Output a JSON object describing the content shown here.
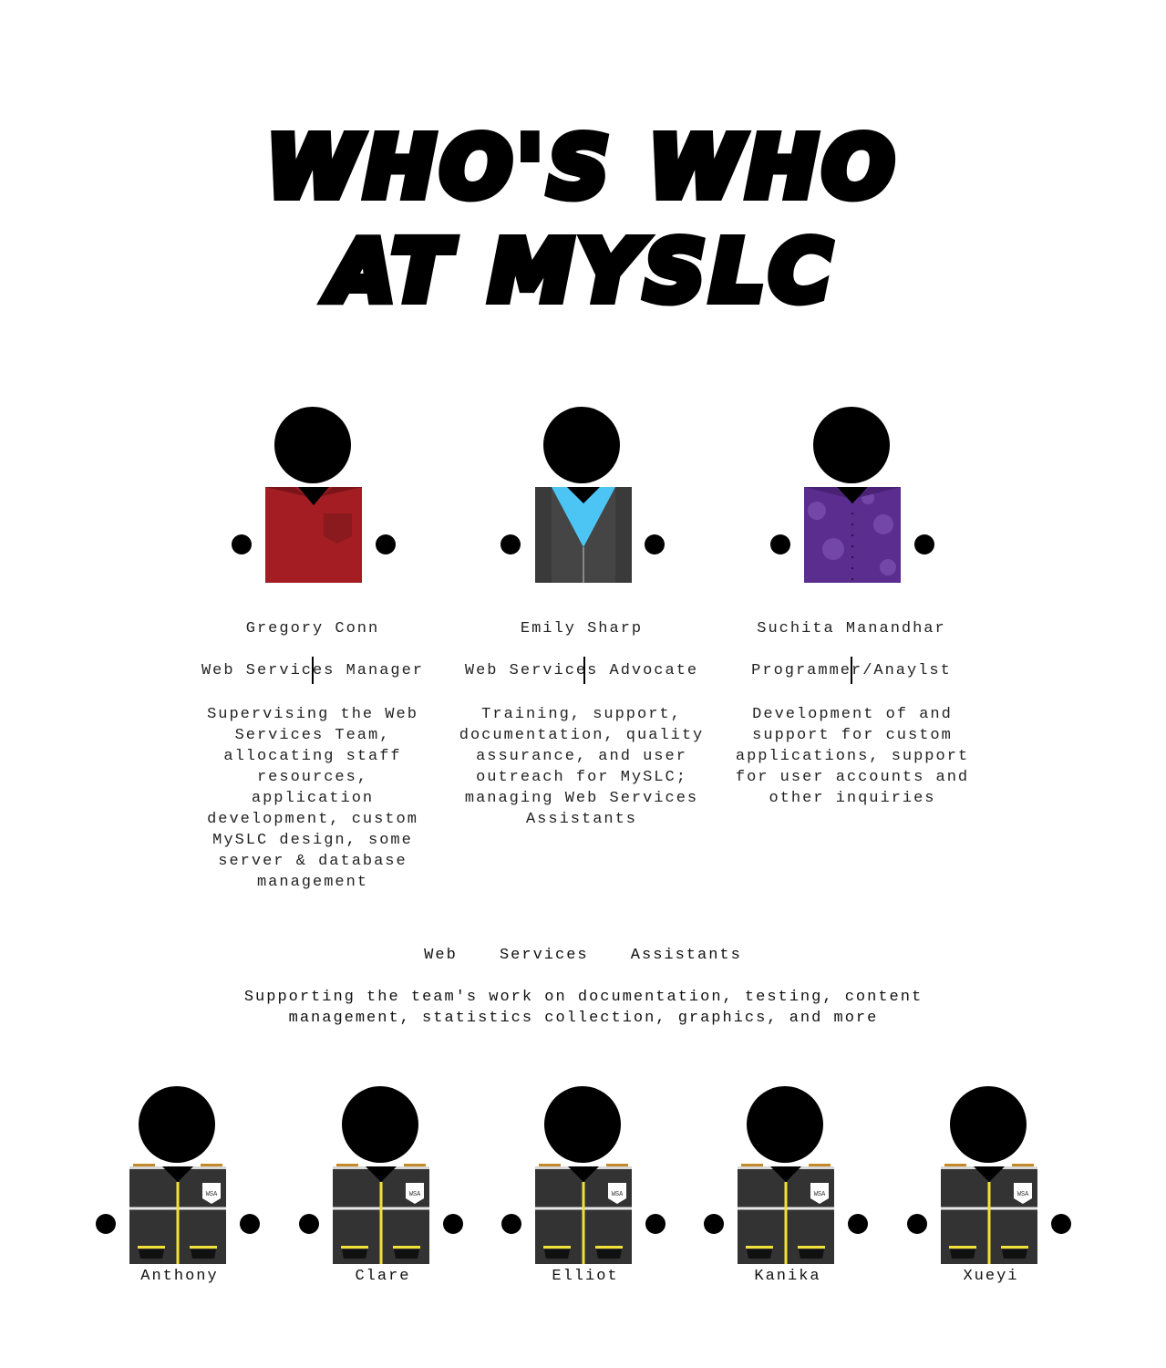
{
  "title": {
    "line1": "Who's Who",
    "line2": "at MySLC"
  },
  "staff": [
    {
      "name": "Gregory Conn",
      "role": "Web Services Manager",
      "description": "Supervising the Web Services Team, allocating staff resources, application development, custom MySLC design, some server & database management",
      "shirt_color": "#a31d22"
    },
    {
      "name": "Emily Sharp",
      "role": "Web Services Advocate",
      "description": "Training, support, documentation, quality assurance, and user outreach for MySLC; managing Web Services Assistants",
      "shirt_color": "#454545"
    },
    {
      "name": "Suchita Manandhar",
      "role": "Programmer/Anaylst",
      "description": "Development of and support for custom applications, support for user accounts and other inquiries",
      "shirt_color": "#5b2d8e"
    }
  ],
  "assistants": {
    "heading": "Web Services Assistants",
    "description": "Supporting the team's work on documentation, testing, content management, statistics collection, graphics, and more",
    "badge": "WSA",
    "names": [
      "Anthony",
      "Clare",
      "Elliot",
      "Kanika",
      "Xueyi"
    ]
  }
}
